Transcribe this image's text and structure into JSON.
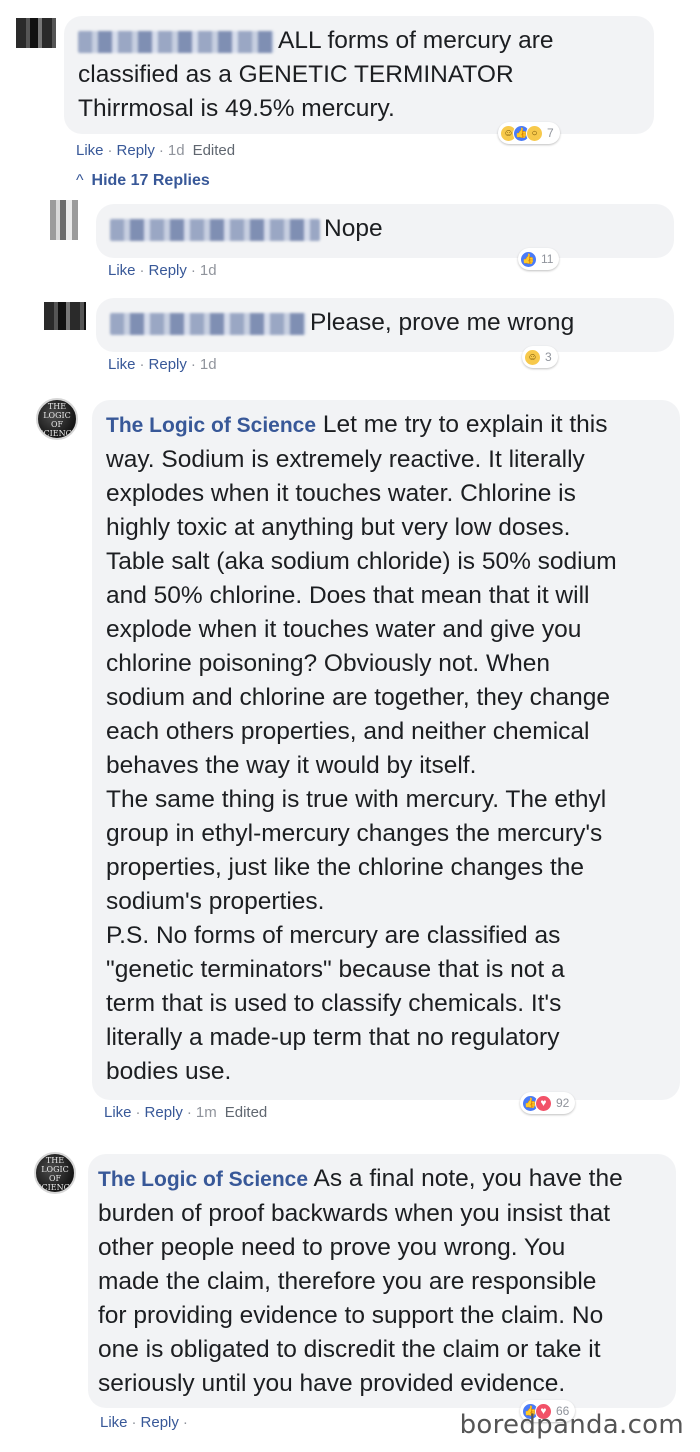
{
  "comments": [
    {
      "text": "ALL forms of mercury are classified as a GENETIC TERMINATOR Thirrmosal is 49.5% mercury.",
      "line1": "ALL forms of mercury are",
      "line2": "classified as a GENETIC TERMINATOR",
      "line3": "Thirrmosal is 49.5% mercury.",
      "like": "Like",
      "reply": "Reply",
      "time": "1d",
      "edited": "Edited",
      "reaction_count": "7"
    },
    {
      "text": "Nope",
      "like": "Like",
      "reply": "Reply",
      "time": "1d",
      "reaction_count": "11"
    },
    {
      "text": "Please, prove me wrong",
      "like": "Like",
      "reply": "Reply",
      "time": "1d",
      "reaction_count": "3"
    },
    {
      "author": "The Logic of Science",
      "lines": [
        "Let me try to explain it this",
        "way. Sodium is extremely reactive. It literally",
        "explodes when it touches water. Chlorine is",
        "highly toxic at anything but very low doses.",
        "Table salt (aka sodium chloride) is 50% sodium",
        "and 50% chlorine. Does that mean that it will",
        "explode when it touches water and give you",
        "chlorine poisoning? Obviously not. When",
        "sodium and chlorine are together, they change",
        "each others properties, and neither chemical",
        "behaves the way it would by itself.",
        "The same thing is true with mercury. The ethyl",
        "group in ethyl-mercury changes the mercury's",
        "properties, just like the chlorine changes the",
        "sodium's properties.",
        "P.S. No forms of mercury are classified as",
        "\"genetic terminators\" because that is not a",
        "term that is used to classify chemicals. It's",
        "literally a made-up term that no regulatory",
        "bodies use."
      ],
      "like": "Like",
      "reply": "Reply",
      "time": "1m",
      "edited": "Edited",
      "reaction_count": "92"
    },
    {
      "author": "The Logic of Science",
      "lines": [
        "As a final note, you have the",
        "burden of proof backwards when you insist that",
        "other people need to prove you wrong. You",
        "made the claim, therefore you are responsible",
        "for providing evidence to support the claim. No",
        "one is obligated to discredit the claim or take it",
        "seriously until you have provided evidence."
      ],
      "like": "Like",
      "reply": "Reply",
      "reaction_count": "66"
    }
  ],
  "hide_replies": "Hide 17 Replies",
  "logo_text": [
    "THE",
    "LOGIC",
    "OF",
    "SCIENCE"
  ],
  "watermark": "boredpanda.com",
  "colors": {
    "link": "#385898",
    "bubble": "#f2f3f5",
    "meta": "#90949c",
    "like": "#4a7bf7",
    "love": "#f25268"
  }
}
